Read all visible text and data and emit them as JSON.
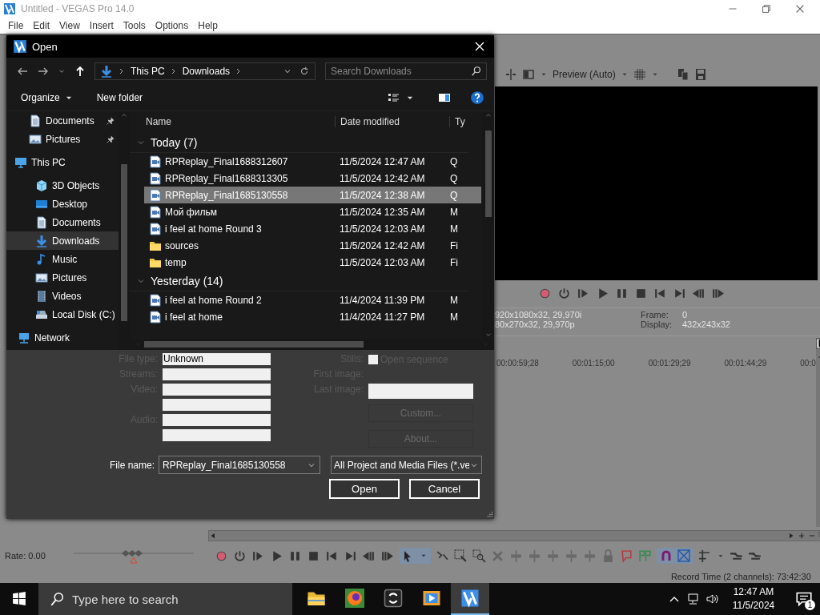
{
  "app": {
    "title": "Untitled - VEGAS Pro 14.0",
    "menu": [
      "File",
      "Edit",
      "View",
      "Insert",
      "Tools",
      "Options",
      "Help"
    ]
  },
  "preview": {
    "quality": "Preview (Auto)",
    "project_line": "920x1080x32, 29,970i",
    "preview_line": "80x270x32, 29,970p",
    "frame_label": "Frame:",
    "frame": "0",
    "display_label": "Display:",
    "display": "432x243x32"
  },
  "timeline": {
    "ruler": [
      "00:00:59;28",
      "00:01:15;00",
      "00:01:29;29",
      "00:01:44;29",
      "00:0"
    ],
    "rate": "Rate: 0.00",
    "rate_slider": {
      "level": 0.5
    },
    "record_time": "Record Time (2 channels): 73:42:30"
  },
  "dialog": {
    "title": "Open",
    "path": [
      "This PC",
      "Downloads"
    ],
    "search_placeholder": "Search Downloads",
    "toolbar": [
      "Organize",
      "New folder"
    ],
    "nav": [
      {
        "label": "Documents",
        "kind": "documents",
        "pinned": true,
        "selected": false
      },
      {
        "label": "Pictures",
        "kind": "pictures",
        "pinned": true,
        "selected": false
      },
      {
        "label": "This PC",
        "kind": "pc",
        "pinned": false,
        "selected": false,
        "children": [
          {
            "label": "3D Objects",
            "kind": "objects",
            "pinned": false,
            "selected": false
          },
          {
            "label": "Desktop",
            "kind": "desktop",
            "pinned": false,
            "selected": false
          },
          {
            "label": "Documents",
            "kind": "documents",
            "pinned": false,
            "selected": false
          },
          {
            "label": "Downloads",
            "kind": "downloads",
            "pinned": false,
            "selected": true
          },
          {
            "label": "Music",
            "kind": "music",
            "pinned": false,
            "selected": false
          },
          {
            "label": "Pictures",
            "kind": "pictures",
            "pinned": false,
            "selected": false
          },
          {
            "label": "Videos",
            "kind": "videos",
            "pinned": false,
            "selected": false
          },
          {
            "label": "Local Disk (C:)",
            "kind": "disk",
            "pinned": false,
            "selected": false
          }
        ]
      },
      {
        "label": "Network",
        "kind": "network",
        "pinned": false,
        "selected": false
      }
    ],
    "columns": [
      "Name",
      "Date modified",
      "Ty"
    ],
    "groups": [
      {
        "label": "Today (7)",
        "expanded": true,
        "files": [
          {
            "name": "RPReplay_Final1688312607",
            "date": "11/5/2024 12:47 AM",
            "column_3": "Q",
            "kind": "media",
            "selected": false
          },
          {
            "name": "RPReplay_Final1688313305",
            "date": "11/5/2024 12:42 AM",
            "column_3": "Q",
            "kind": "media",
            "selected": false
          },
          {
            "name": "RPReplay_Final1685130558",
            "date": "11/5/2024 12:38 AM",
            "column_3": "Q",
            "kind": "media",
            "selected": true
          },
          {
            "name": "Мой фильм",
            "date": "11/5/2024 12:35 AM",
            "column_3": "M",
            "kind": "media",
            "selected": false
          },
          {
            "name": "i feel at home Round 3",
            "date": "11/5/2024 12:03 AM",
            "column_3": "M",
            "kind": "media",
            "selected": false
          },
          {
            "name": "sources",
            "date": "11/5/2024 12:42 AM",
            "column_3": "Fi",
            "kind": "folder",
            "selected": false
          },
          {
            "name": "temp",
            "date": "11/5/2024 12:03 AM",
            "column_3": "Fi",
            "kind": "folder",
            "selected": false
          }
        ]
      },
      {
        "label": "Yesterday (14)",
        "expanded": true,
        "files": [
          {
            "name": "i feel at home Round 2",
            "date": "11/4/2024 11:39 PM",
            "column_3": "M",
            "kind": "media",
            "selected": false
          },
          {
            "name": "i feel at home",
            "date": "11/4/2024 11:27 PM",
            "column_3": "M",
            "kind": "media",
            "selected": false
          }
        ]
      }
    ],
    "properties": [
      {
        "kind": "labeled",
        "label": "File type:",
        "value": "Unknown"
      },
      {
        "kind": "labeled",
        "label": "Streams:"
      },
      {
        "kind": "labeled",
        "label": "Video:"
      },
      {
        "kind": "extra"
      },
      {
        "kind": "labeled",
        "label": "Audio:"
      },
      {
        "kind": "extra"
      }
    ],
    "stills": {
      "label": "Stills:",
      "checkbox": "Open sequence",
      "checked": false,
      "disabled": true,
      "first_image": "First image:",
      "last_image": "Last image:"
    },
    "side_buttons": [
      {
        "label": "Custom...",
        "disabled": true
      },
      {
        "label": "About...",
        "disabled": true
      }
    ],
    "file_name": {
      "label": "File name:",
      "value": "RPReplay_Final1685130558"
    },
    "filter": "All Project and Media Files (*.ve",
    "actions": [
      "Open",
      "Cancel"
    ]
  },
  "taskbar": {
    "search_placeholder": "Type here to search",
    "apps": [
      {
        "kind": "folder",
        "active": false
      },
      {
        "kind": "browser",
        "active": false
      },
      {
        "kind": "sync",
        "active": false
      },
      {
        "kind": "player",
        "active": false
      },
      {
        "kind": "vegas",
        "active": true
      }
    ],
    "time": "12:47 AM",
    "date": "11/5/2024",
    "notifications": "1"
  }
}
